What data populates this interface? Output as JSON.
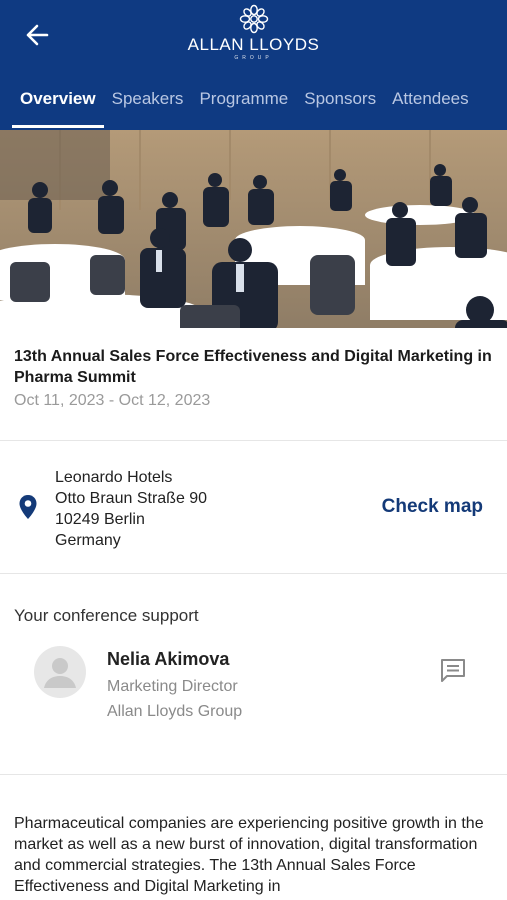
{
  "header": {
    "logo_name": "ALLAN LLOYDS",
    "logo_sub": "GROUP",
    "tabs": [
      {
        "label": "Overview"
      },
      {
        "label": "Speakers"
      },
      {
        "label": "Programme"
      },
      {
        "label": "Sponsors"
      },
      {
        "label": "Attendees"
      }
    ],
    "active_tab": "Overview"
  },
  "event": {
    "title": "13th Annual Sales Force Effectiveness and Digital Marketing in Pharma Summit",
    "dates": "Oct 11, 2023 - Oct 12, 2023"
  },
  "location": {
    "lines": [
      "Leonardo Hotels",
      "Otto Braun Straße 90",
      "10249 Berlin",
      "Germany"
    ],
    "check_map_label": "Check map"
  },
  "support": {
    "title": "Your conference support",
    "name": "Nelia Akimova",
    "role": "Marketing Director",
    "company": "Allan Lloyds Group"
  },
  "description": "Pharmaceutical companies are experiencing positive growth in the market as well as a new burst of innovation, digital transformation and commercial strategies. The 13th Annual Sales Force Effectiveness and Digital Marketing in",
  "colors": {
    "header_bg": "#0f3a82",
    "accent": "#143a78",
    "muted_text": "#9a9a9a"
  },
  "icons": {
    "back": "arrow-left-icon",
    "logo": "snowflake-logo-icon",
    "location": "location-pin-icon",
    "chat": "chat-message-icon",
    "avatar": "person-placeholder-icon"
  }
}
